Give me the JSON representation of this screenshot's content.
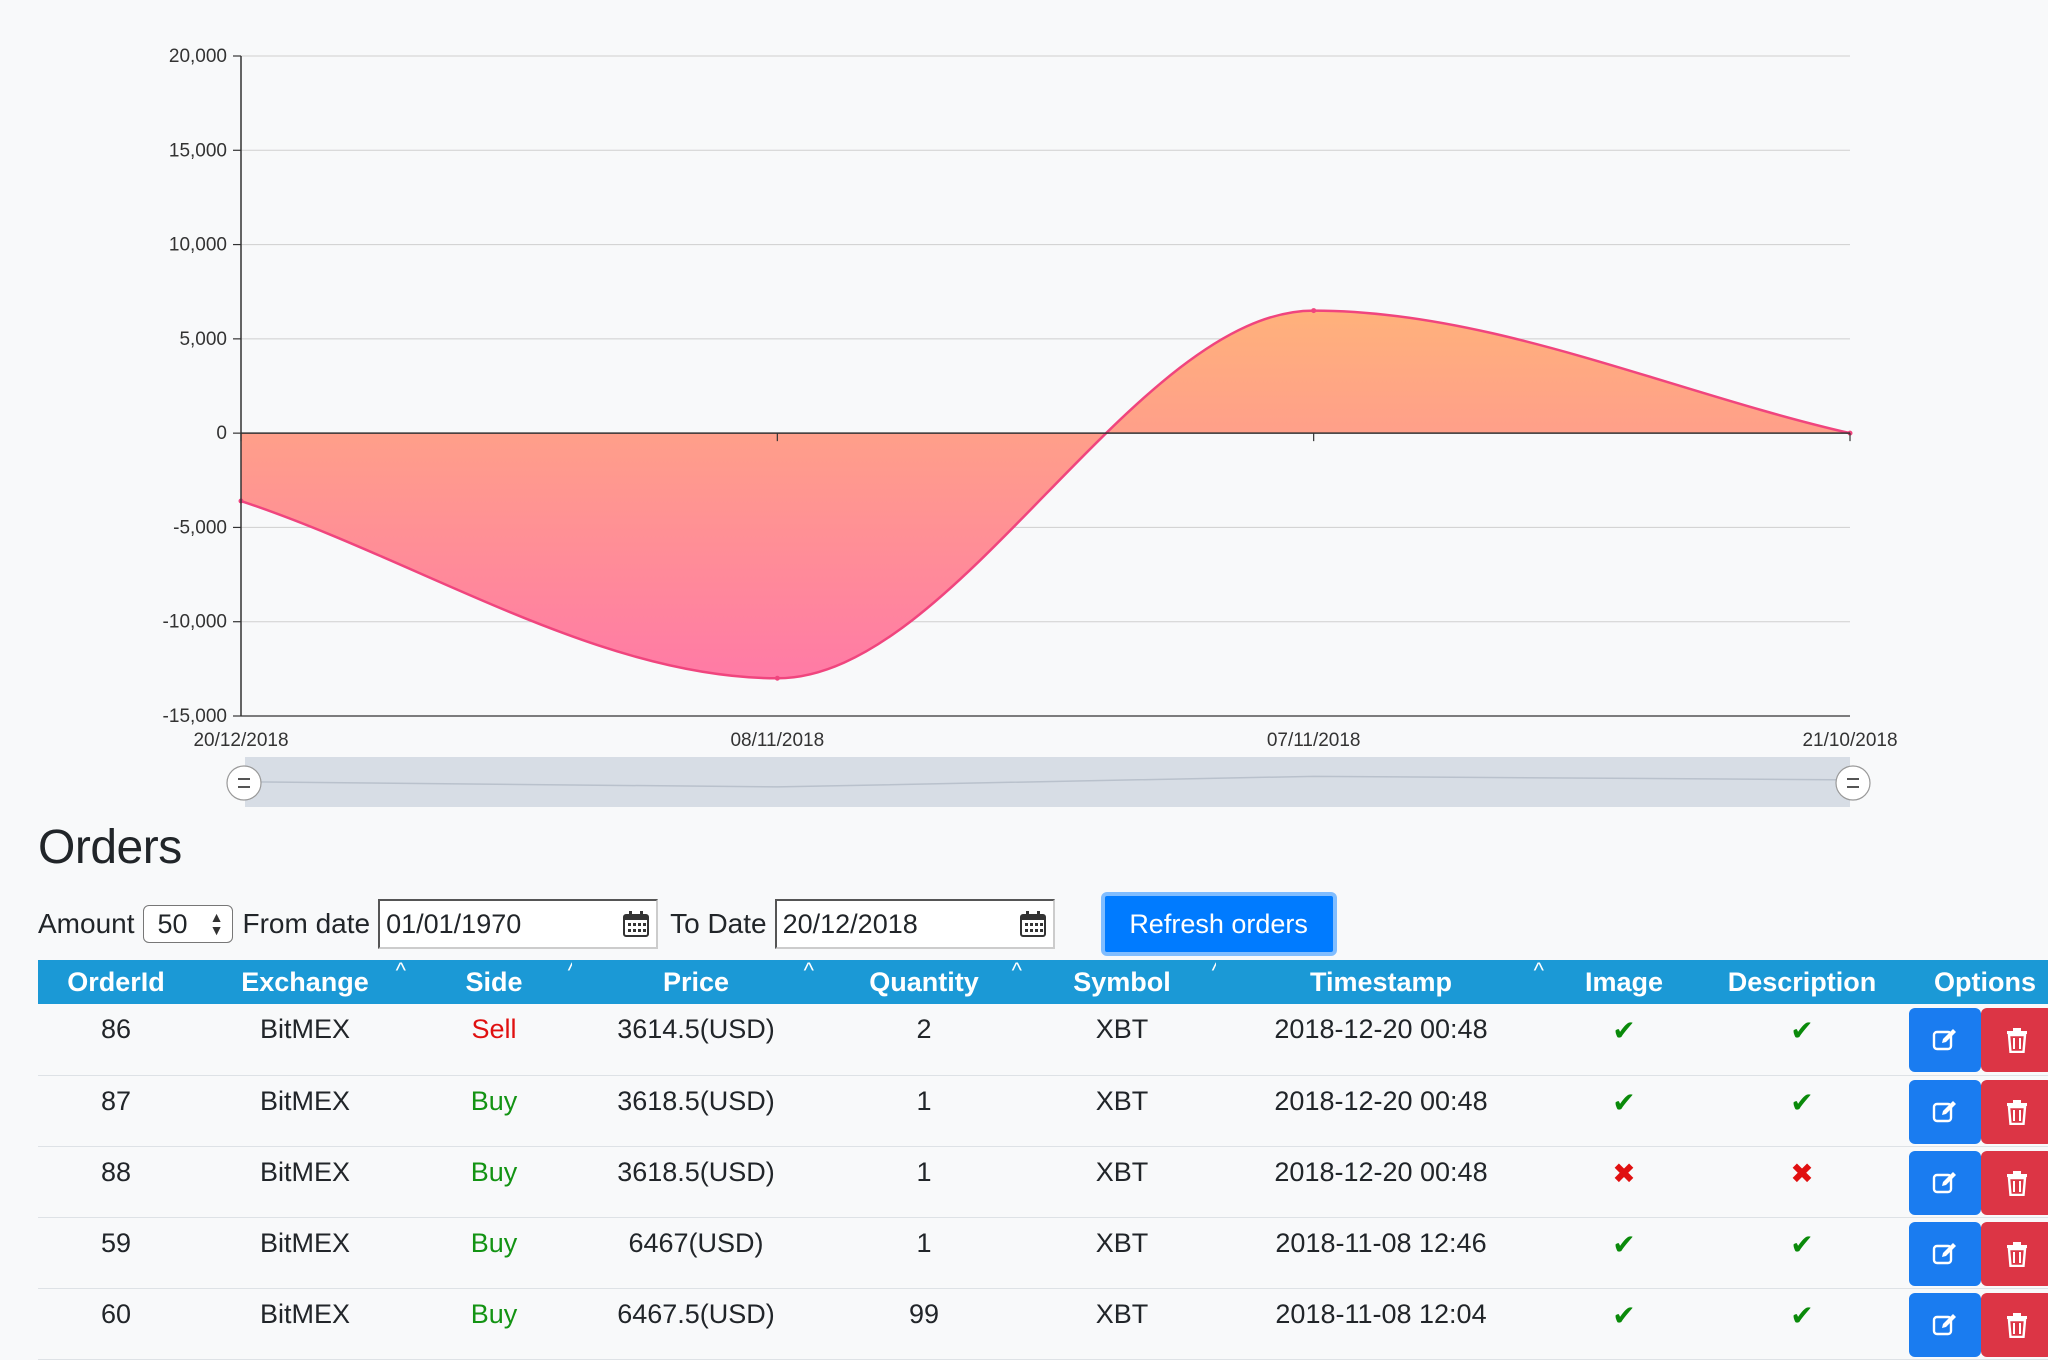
{
  "chart_data": {
    "type": "area",
    "title": "",
    "xlabel": "",
    "ylabel": "",
    "x": [
      "20/12/2018",
      "08/11/2018",
      "07/11/2018",
      "21/10/2018"
    ],
    "values": [
      -3600,
      -13000,
      6500,
      0
    ],
    "ylim": [
      -15000,
      20000
    ],
    "yticks": [
      -15000,
      -10000,
      -5000,
      0,
      5000,
      10000,
      15000,
      20000
    ],
    "ytick_labels": [
      "-15,000",
      "-10,000",
      "-5,000",
      "0",
      "5,000",
      "10,000",
      "15,000",
      "20,000"
    ],
    "grid": true,
    "colors": {
      "line": "#f0457e",
      "fill_top": "#ffb37a",
      "fill_bottom": "#ff7aa6",
      "navigator": "#d7dde5"
    }
  },
  "orders_section": {
    "title": "Orders",
    "amount_label": "Amount",
    "amount_value": "50",
    "from_label": "From date",
    "from_value": "01/01/1970",
    "to_label": "To Date",
    "to_value": "20/12/2018",
    "refresh_label": "Refresh orders"
  },
  "table": {
    "headers": [
      "OrderId",
      "Exchange",
      "Side",
      "Price",
      "Quantity",
      "Symbol",
      "Timestamp",
      "Image",
      "Description",
      "Options"
    ],
    "sort_caret": "^",
    "check_glyph": "✔",
    "cross_glyph": "✖",
    "rows": [
      {
        "id": "86",
        "exchange": "BitMEX",
        "side": "Sell",
        "price": "3614.5(USD)",
        "quantity": "2",
        "symbol": "XBT",
        "timestamp": "2018-12-20 00:48",
        "image": true,
        "description": true
      },
      {
        "id": "87",
        "exchange": "BitMEX",
        "side": "Buy",
        "price": "3618.5(USD)",
        "quantity": "1",
        "symbol": "XBT",
        "timestamp": "2018-12-20 00:48",
        "image": true,
        "description": true
      },
      {
        "id": "88",
        "exchange": "BitMEX",
        "side": "Buy",
        "price": "3618.5(USD)",
        "quantity": "1",
        "symbol": "XBT",
        "timestamp": "2018-12-20 00:48",
        "image": false,
        "description": false
      },
      {
        "id": "59",
        "exchange": "BitMEX",
        "side": "Buy",
        "price": "6467(USD)",
        "quantity": "1",
        "symbol": "XBT",
        "timestamp": "2018-11-08 12:46",
        "image": true,
        "description": true
      },
      {
        "id": "60",
        "exchange": "BitMEX",
        "side": "Buy",
        "price": "6467.5(USD)",
        "quantity": "99",
        "symbol": "XBT",
        "timestamp": "2018-11-08 12:04",
        "image": true,
        "description": true
      }
    ]
  }
}
